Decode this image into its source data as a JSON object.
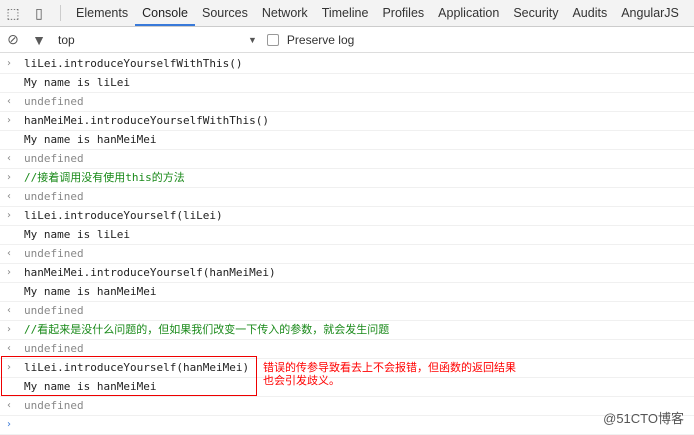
{
  "tabs": [
    "Elements",
    "Console",
    "Sources",
    "Network",
    "Timeline",
    "Profiles",
    "Application",
    "Security",
    "Audits",
    "AngularJS"
  ],
  "active_tab": "Console",
  "toolbar": {
    "context": "top",
    "preserve_log": "Preserve log"
  },
  "rows": [
    {
      "type": "in",
      "text": "liLei.introduceYourselfWithThis()"
    },
    {
      "type": "out",
      "text": "My name is liLei"
    },
    {
      "type": "res",
      "text": "undefined"
    },
    {
      "type": "in",
      "text": "hanMeiMei.introduceYourselfWithThis()"
    },
    {
      "type": "out",
      "text": "My name is hanMeiMei"
    },
    {
      "type": "res",
      "text": "undefined"
    },
    {
      "type": "comment",
      "text": "//接着调用没有使用this的方法"
    },
    {
      "type": "res",
      "text": "undefined"
    },
    {
      "type": "in",
      "text": "liLei.introduceYourself(liLei)"
    },
    {
      "type": "out",
      "text": "My name is liLei"
    },
    {
      "type": "res",
      "text": "undefined"
    },
    {
      "type": "in",
      "text": "hanMeiMei.introduceYourself(hanMeiMei)"
    },
    {
      "type": "out",
      "text": "My name is hanMeiMei"
    },
    {
      "type": "res",
      "text": "undefined"
    },
    {
      "type": "comment",
      "text": "//看起来是没什么问题的，但如果我们改变一下传入的参数，就会发生问题"
    },
    {
      "type": "res",
      "text": "undefined"
    },
    {
      "type": "in",
      "text": "liLei.introduceYourself(hanMeiMei)"
    },
    {
      "type": "out",
      "text": "My name is hanMeiMei"
    },
    {
      "type": "res",
      "text": "undefined"
    },
    {
      "type": "prompt",
      "text": ""
    }
  ],
  "annotation": "错误的传参导致看去上不会报错，但函数的返回结果也会引发歧义。",
  "watermark": "@51CTO博客"
}
